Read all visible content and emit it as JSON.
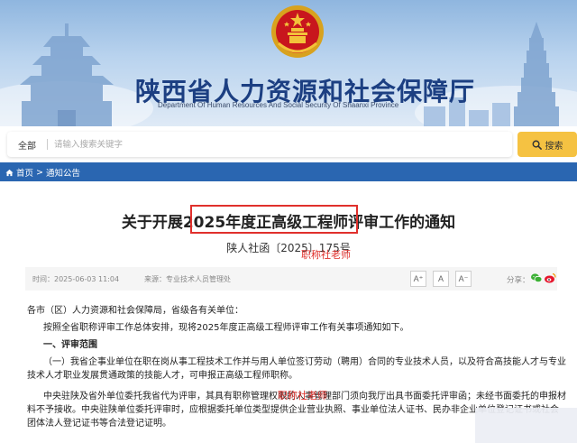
{
  "header": {
    "org_title": "陕西省人力资源和社会保障厅",
    "org_subtitle": "Department Of Human Resources And Social Security Of Shaanxi Province",
    "colors": {
      "title": "#1c3f82",
      "banner_top": "#8fb6df",
      "banner_bottom": "#dfeaf6"
    }
  },
  "search": {
    "scope": "全部",
    "placeholder": "请输入搜索关键字",
    "value": "",
    "button_label": "搜索",
    "button_color": "#f5c242"
  },
  "breadcrumb": {
    "items": [
      "首页",
      "通知公告"
    ],
    "separator": ">",
    "bar_color": "#2a66b1"
  },
  "article": {
    "title": "关于开展2025年度正高级工程师评审工作的通知",
    "doc_number": "陕人社函〔2025〕175号",
    "watermarks": [
      "职称社老师",
      "职称社老师"
    ],
    "meta": {
      "time": "时间：2025-06-03 11:04",
      "source": "来源：专业技术人员管理处",
      "font_buttons": [
        "A⁺",
        "A",
        "A⁻"
      ],
      "share_label": "分享："
    },
    "paragraphs": [
      "各市（区）人力资源和社会保障局，省级各有关单位：",
      "按照全省职称评审工作总体安排，现将2025年度正高级工程师评审工作有关事项通知如下。",
      "一、评审范围",
      "（一）我省企事业单位在职在岗从事工程技术工作并与用人单位签订劳动（聘用）合同的专业技术人员，以及符合高技能人才与专业技术人才职业发展贯通政策的技能人才，可申报正高级工程师职称。",
      "中央驻陕及省外单位委托我省代为评审，其具有职称管理权限的人事管理部门须向我厅出具书面委托评审函；未经书面委托的申报材料不予接收。中央驻陕单位委托评审时，应根据委托单位类型提供企业营业执照、事业单位法人证书、民办非企业单位登记证书或社会团体法人登记证书等合法登记证明。"
    ]
  },
  "icons": [
    "national-emblem-icon",
    "home-icon",
    "search-icon",
    "wechat-icon",
    "weibo-icon"
  ]
}
